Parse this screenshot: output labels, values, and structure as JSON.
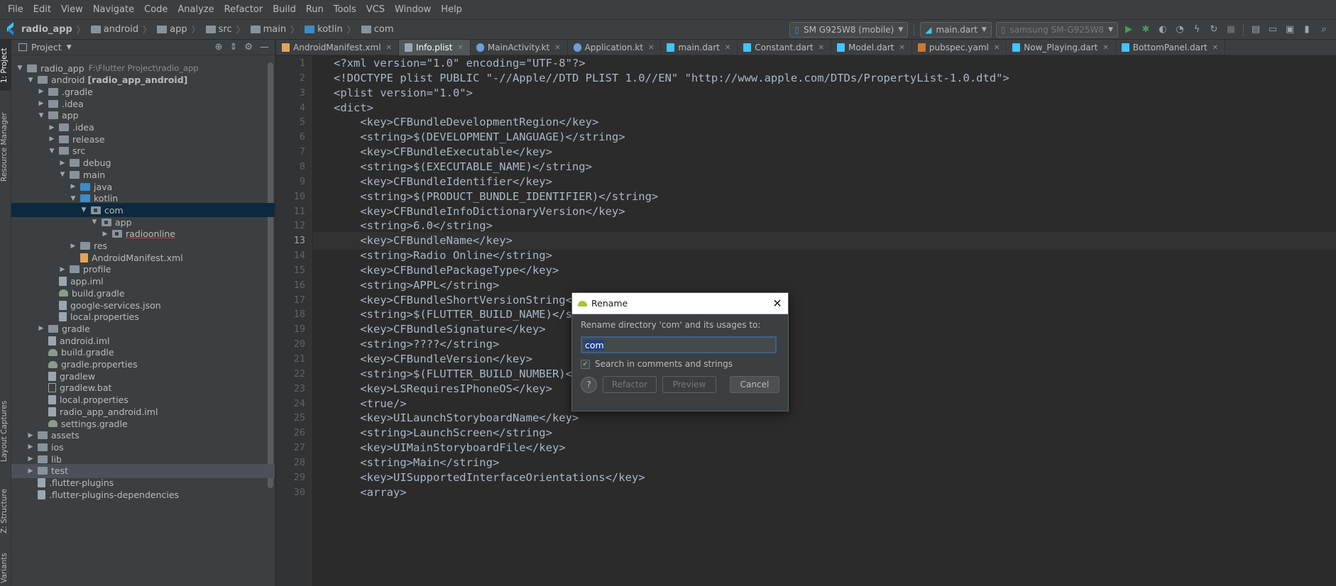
{
  "menu": [
    "File",
    "Edit",
    "View",
    "Navigate",
    "Code",
    "Analyze",
    "Refactor",
    "Build",
    "Run",
    "Tools",
    "VCS",
    "Window",
    "Help"
  ],
  "breadcrumb": [
    "radio_app",
    "android",
    "app",
    "src",
    "main",
    "kotlin",
    "com"
  ],
  "toolbar": {
    "device": "SM G925W8 (mobile)",
    "run_config": "main.dart",
    "target": "samsung SM-G925W8"
  },
  "left_tabs": [
    "1: Project",
    "Resource Manager",
    "Layout Captures",
    "Z: Structure",
    "Variants"
  ],
  "project_panel": {
    "title": "Project",
    "tree": [
      {
        "label": "radio_app",
        "suffix": "F:\\Flutter Project\\radio_app",
        "depth": 0,
        "open": true,
        "icon": "folder"
      },
      {
        "label": "android",
        "bold": "[radio_app_android]",
        "depth": 1,
        "open": true,
        "icon": "folder"
      },
      {
        "label": ".gradle",
        "depth": 2,
        "open": false,
        "icon": "folder"
      },
      {
        "label": ".idea",
        "depth": 2,
        "open": false,
        "icon": "folder"
      },
      {
        "label": "app",
        "depth": 2,
        "open": true,
        "icon": "folder"
      },
      {
        "label": ".idea",
        "depth": 3,
        "open": false,
        "icon": "folder"
      },
      {
        "label": "release",
        "depth": 3,
        "open": false,
        "icon": "folder"
      },
      {
        "label": "src",
        "depth": 3,
        "open": true,
        "icon": "folder"
      },
      {
        "label": "debug",
        "depth": 4,
        "open": false,
        "icon": "folder"
      },
      {
        "label": "main",
        "depth": 4,
        "open": true,
        "icon": "folder"
      },
      {
        "label": "java",
        "depth": 5,
        "open": false,
        "icon": "folder-blue"
      },
      {
        "label": "kotlin",
        "depth": 5,
        "open": true,
        "icon": "folder-blue"
      },
      {
        "label": "com",
        "depth": 6,
        "open": true,
        "icon": "folder-pkg"
      },
      {
        "label": "app",
        "depth": 7,
        "open": true,
        "icon": "folder-pkg"
      },
      {
        "label": "radioonline",
        "depth": 8,
        "open": false,
        "icon": "folder-pkg"
      },
      {
        "label": "res",
        "depth": 5,
        "open": false,
        "icon": "folder"
      },
      {
        "label": "AndroidManifest.xml",
        "depth": 5,
        "leaf": true,
        "icon": "file-xml"
      },
      {
        "label": "profile",
        "depth": 4,
        "open": false,
        "icon": "folder"
      },
      {
        "label": "app.iml",
        "depth": 3,
        "leaf": true,
        "icon": "file"
      },
      {
        "label": "build.gradle",
        "depth": 3,
        "leaf": true,
        "icon": "file-gradle"
      },
      {
        "label": "google-services.json",
        "depth": 3,
        "leaf": true,
        "icon": "file-props"
      },
      {
        "label": "local.properties",
        "depth": 3,
        "leaf": true,
        "icon": "file-props"
      },
      {
        "label": "gradle",
        "depth": 2,
        "open": false,
        "icon": "folder"
      },
      {
        "label": "android.iml",
        "depth": 2,
        "leaf": true,
        "icon": "file"
      },
      {
        "label": "build.gradle",
        "depth": 2,
        "leaf": true,
        "icon": "file-gradle"
      },
      {
        "label": "gradle.properties",
        "depth": 2,
        "leaf": true,
        "icon": "file-gradle"
      },
      {
        "label": "gradlew",
        "depth": 2,
        "leaf": true,
        "icon": "file"
      },
      {
        "label": "gradlew.bat",
        "depth": 2,
        "leaf": true,
        "icon": "file-bat"
      },
      {
        "label": "local.properties",
        "depth": 2,
        "leaf": true,
        "icon": "file-props"
      },
      {
        "label": "radio_app_android.iml",
        "depth": 2,
        "leaf": true,
        "icon": "file"
      },
      {
        "label": "settings.gradle",
        "depth": 2,
        "leaf": true,
        "icon": "file-gradle"
      },
      {
        "label": "assets",
        "depth": 1,
        "open": false,
        "icon": "folder"
      },
      {
        "label": "ios",
        "depth": 1,
        "open": false,
        "icon": "folder"
      },
      {
        "label": "lib",
        "depth": 1,
        "open": false,
        "icon": "folder"
      },
      {
        "label": "test",
        "depth": 1,
        "open": false,
        "icon": "folder"
      },
      {
        "label": ".flutter-plugins",
        "depth": 1,
        "leaf": true,
        "icon": "file"
      },
      {
        "label": ".flutter-plugins-dependencies",
        "depth": 1,
        "leaf": true,
        "icon": "file"
      }
    ]
  },
  "tabs": [
    {
      "label": "AndroidManifest.xml",
      "icon": "xml"
    },
    {
      "label": "Info.plist",
      "icon": "plist",
      "active": true
    },
    {
      "label": "MainActivity.kt",
      "icon": "kt"
    },
    {
      "label": "Application.kt",
      "icon": "kt"
    },
    {
      "label": "main.dart",
      "icon": "dart"
    },
    {
      "label": "Constant.dart",
      "icon": "dart"
    },
    {
      "label": "Model.dart",
      "icon": "dart"
    },
    {
      "label": "pubspec.yaml",
      "icon": "yaml"
    },
    {
      "label": "Now_Playing.dart",
      "icon": "dart"
    },
    {
      "label": "BottomPanel.dart",
      "icon": "dart"
    }
  ],
  "editor": {
    "current_line": 13,
    "lines": [
      "<?xml version=\"1.0\" encoding=\"UTF-8\"?>",
      "<!DOCTYPE plist PUBLIC \"-//Apple//DTD PLIST 1.0//EN\" \"http://www.apple.com/DTDs/PropertyList-1.0.dtd\">",
      "<plist version=\"1.0\">",
      "<dict>",
      "    <key>CFBundleDevelopmentRegion</key>",
      "    <string>$(DEVELOPMENT_LANGUAGE)</string>",
      "    <key>CFBundleExecutable</key>",
      "    <string>$(EXECUTABLE_NAME)</string>",
      "    <key>CFBundleIdentifier</key>",
      "    <string>$(PRODUCT_BUNDLE_IDENTIFIER)</string>",
      "    <key>CFBundleInfoDictionaryVersion</key>",
      "    <string>6.0</string>",
      "    <key>CFBundleName</key>",
      "    <string>Radio Online</string>",
      "    <key>CFBundlePackageType</key>",
      "    <string>APPL</string>",
      "    <key>CFBundleShortVersionString</key>",
      "    <string>$(FLUTTER_BUILD_NAME)</string>",
      "    <key>CFBundleSignature</key>",
      "    <string>????</string>",
      "    <key>CFBundleVersion</key>",
      "    <string>$(FLUTTER_BUILD_NUMBER)</string>",
      "    <key>LSRequiresIPhoneOS</key>",
      "    <true/>",
      "    <key>UILaunchStoryboardName</key>",
      "    <string>LaunchScreen</string>",
      "    <key>UIMainStoryboardFile</key>",
      "    <string>Main</string>",
      "    <key>UISupportedInterfaceOrientations</key>",
      "    <array>"
    ]
  },
  "dialog": {
    "title": "Rename",
    "prompt": "Rename directory 'com' and its usages to:",
    "input_value": "com",
    "checkbox_label": "Search in comments and strings",
    "checkbox_checked": true,
    "help": "?",
    "refactor": "Refactor",
    "preview": "Preview",
    "cancel": "Cancel"
  }
}
